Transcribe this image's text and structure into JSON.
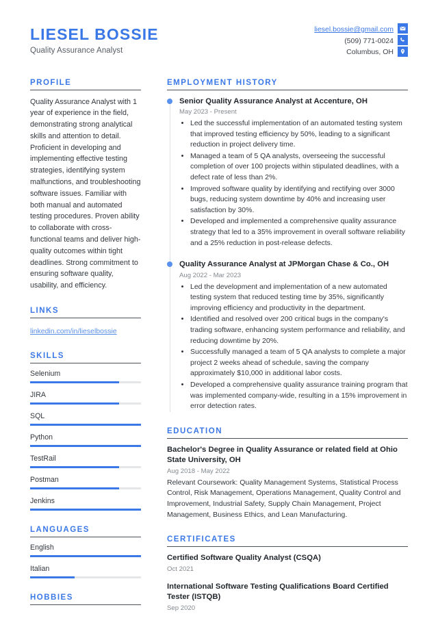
{
  "header": {
    "name": "LIESEL BOSSIE",
    "job_title": "Quality Assurance Analyst",
    "contact": {
      "email": "liesel.bossie@gmail.com",
      "phone": "(509) 771-0024",
      "location": "Columbus, OH",
      "icons": [
        "envelope-icon",
        "phone-icon",
        "map-pin-icon"
      ]
    },
    "accent_color": "#3b78e7"
  },
  "sidebar": {
    "profile": {
      "heading": "PROFILE",
      "text": "Quality Assurance Analyst with 1 year of experience in the field, demonstrating strong analytical skills and attention to detail. Proficient in developing and implementing effective testing strategies, identifying system malfunctions, and troubleshooting software issues. Familiar with both manual and automated testing procedures. Proven ability to collaborate with cross-functional teams and deliver high-quality outcomes within tight deadlines. Strong commitment to ensuring software quality, usability, and efficiency."
    },
    "links": {
      "heading": "LINKS",
      "items": [
        {
          "label": "linkedin.com/in/lieselbossie"
        }
      ]
    },
    "skills": {
      "heading": "SKILLS",
      "items": [
        {
          "label": "Selenium",
          "level": 80
        },
        {
          "label": "JIRA",
          "level": 80
        },
        {
          "label": "SQL",
          "level": 100
        },
        {
          "label": "Python",
          "level": 100
        },
        {
          "label": "TestRail",
          "level": 80
        },
        {
          "label": "Postman",
          "level": 80
        },
        {
          "label": "Jenkins",
          "level": 100
        }
      ]
    },
    "languages": {
      "heading": "LANGUAGES",
      "items": [
        {
          "label": "English",
          "level": 100
        },
        {
          "label": "Italian",
          "level": 40
        }
      ]
    },
    "hobbies": {
      "heading": "HOBBIES"
    }
  },
  "main": {
    "employment": {
      "heading": "EMPLOYMENT HISTORY",
      "jobs": [
        {
          "title": "Senior Quality Assurance Analyst at Accenture, OH",
          "date": "May 2023 - Present",
          "bullets": [
            "Led the successful implementation of an automated testing system that improved testing efficiency by 50%, leading to a significant reduction in project delivery time.",
            "Managed a team of 5 QA analysts, overseeing the successful completion of over 100 projects within stipulated deadlines, with a defect rate of less than 2%.",
            "Improved software quality by identifying and rectifying over 3000 bugs, reducing system downtime by 40% and increasing user satisfaction by 30%.",
            "Developed and implemented a comprehensive quality assurance strategy that led to a 35% improvement in overall software reliability and a 25% reduction in post-release defects."
          ]
        },
        {
          "title": "Quality Assurance Analyst at JPMorgan Chase & Co., OH",
          "date": "Aug 2022 - Mar 2023",
          "bullets": [
            "Led the development and implementation of a new automated testing system that reduced testing time by 35%, significantly improving efficiency and productivity in the department.",
            "Identified and resolved over 200 critical bugs in the company's trading software, enhancing system performance and reliability, and reducing downtime by 20%.",
            "Successfully managed a team of 5 QA analysts to complete a major project 2 weeks ahead of schedule, saving the company approximately $10,000 in additional labor costs.",
            "Developed a comprehensive quality assurance training program that was implemented company-wide, resulting in a 15% improvement in error detection rates."
          ]
        }
      ]
    },
    "education": {
      "heading": "EDUCATION",
      "entries": [
        {
          "title": "Bachelor's Degree in Quality Assurance or related field at Ohio State University, OH",
          "date": "Aug 2018 - May 2022",
          "description": "Relevant Coursework: Quality Management Systems, Statistical Process Control, Risk Management, Operations Management, Quality Control and Improvement, Industrial Safety, Supply Chain Management, Project Management, Business Ethics, and Lean Manufacturing."
        }
      ]
    },
    "certificates": {
      "heading": "CERTIFICATES",
      "entries": [
        {
          "title": "Certified Software Quality Analyst (CSQA)",
          "date": "Oct 2021"
        },
        {
          "title": "International Software Testing Qualifications Board Certified Tester (ISTQB)",
          "date": "Sep 2020"
        }
      ]
    }
  }
}
